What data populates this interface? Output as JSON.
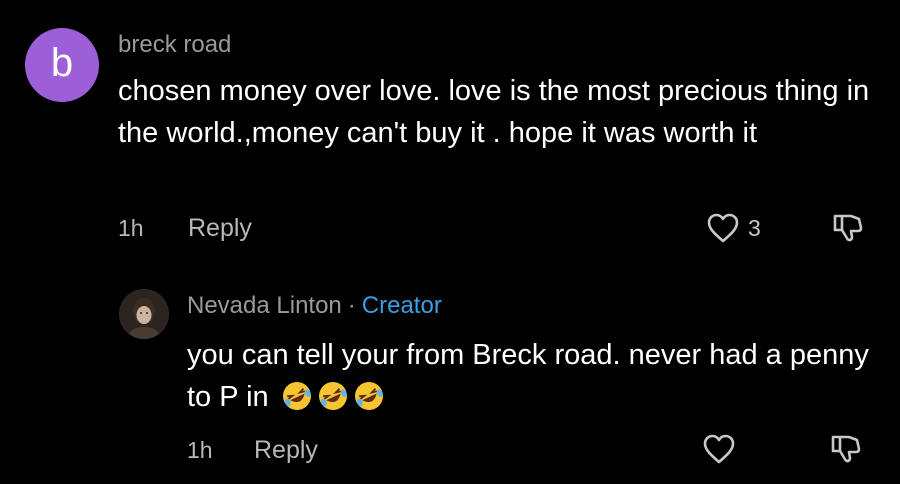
{
  "comments": [
    {
      "avatar_letter": "b",
      "avatar_color": "#9d5fd8",
      "author": "breck road",
      "text": "chosen money over love. love is the most precious thing in the world.,money can't buy it . hope it was worth it",
      "time": "1h",
      "reply_label": "Reply",
      "like_count": "3",
      "like_icon": "heart-outline-icon",
      "dislike_icon": "thumbs-down-icon"
    }
  ],
  "reply": {
    "author": "Nevada Linton",
    "separator": "·",
    "badge": "Creator",
    "badge_color": "#3aa0e2",
    "text": "you can tell your from Breck road. never had a penny to P in",
    "emojis": [
      "rolling-on-floor-laughing-emoji",
      "rolling-on-floor-laughing-emoji",
      "rolling-on-floor-laughing-emoji"
    ],
    "time": "1h",
    "reply_label": "Reply",
    "like_icon": "heart-outline-icon",
    "dislike_icon": "thumbs-down-icon"
  }
}
